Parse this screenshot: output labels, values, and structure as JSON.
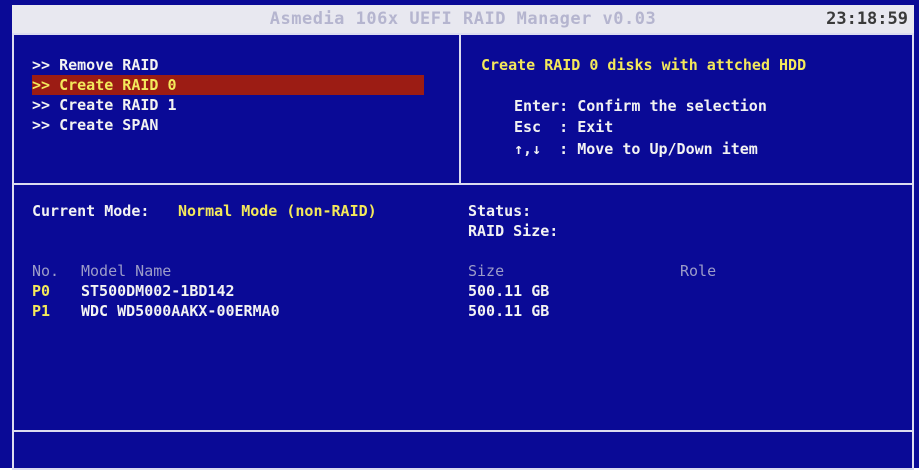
{
  "header": {
    "title": "Asmedia 106x UEFI RAID Manager v0.03",
    "clock": "23:18:59"
  },
  "menu": {
    "items": [
      {
        "label": ">> Remove RAID",
        "selected": false
      },
      {
        "label": ">> Create RAID 0",
        "selected": true
      },
      {
        "label": ">> Create RAID 1",
        "selected": false
      },
      {
        "label": ">> Create SPAN",
        "selected": false
      }
    ]
  },
  "help": {
    "title": "Create RAID 0 disks with attched HDD",
    "lines": [
      "Enter: Confirm the selection",
      "Esc  : Exit",
      "↑,↓  : Move to Up/Down item"
    ]
  },
  "info": {
    "current_mode_label": "Current Mode:",
    "current_mode_value": "Normal Mode (non-RAID)",
    "status_label": "Status:",
    "raid_size_label": "RAID Size:"
  },
  "disks": {
    "headers": {
      "no": "No.",
      "model": "Model Name",
      "size": "Size",
      "role": "Role"
    },
    "rows": [
      {
        "no": "P0",
        "model": "ST500DM002-1BD142",
        "size": "500.11 GB",
        "role": ""
      },
      {
        "no": "P1",
        "model": "WDC WD5000AAKX-00ERMA0",
        "size": "500.11 GB",
        "role": ""
      }
    ]
  },
  "colors": {
    "background": "#0a0a96",
    "selection": "#9c1c14",
    "highlight_text": "#f4e95a",
    "normal_text": "#f2f2f2",
    "dim_text": "#9c9cc8"
  }
}
